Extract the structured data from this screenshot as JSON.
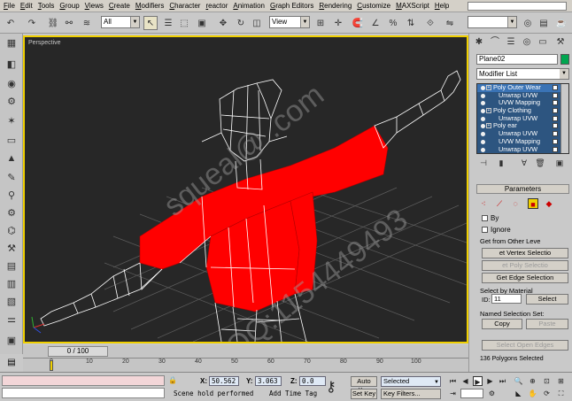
{
  "menubar": {
    "items": [
      "File",
      "Edit",
      "Tools",
      "Group",
      "Views",
      "Create",
      "Modifiers",
      "Character",
      "reactor",
      "Animation",
      "Graph Editors",
      "Rendering",
      "Customize",
      "MAXScript",
      "Help"
    ]
  },
  "toolbar": {
    "selection_filter": "All",
    "ref_coord": "View"
  },
  "viewport": {
    "label": "Perspective",
    "watermark_1": "squeal@ .com",
    "watermark_2": "QQ:1154449493"
  },
  "timeline": {
    "slider_label": "0 / 100",
    "ticks": [
      "0",
      "10",
      "20",
      "30",
      "40",
      "50",
      "60",
      "70",
      "80",
      "90",
      "100"
    ]
  },
  "command_panel": {
    "object_name": "Plane02",
    "modifier_list": "Modifier List",
    "stack": [
      {
        "label": "Poly Outer Wear",
        "selected": true,
        "sub": false
      },
      {
        "label": "Unwrap UVW",
        "selected": false,
        "sub": true
      },
      {
        "label": "UVW Mapping",
        "selected": false,
        "sub": true
      },
      {
        "label": "Poly Clothing",
        "selected": false,
        "sub": false
      },
      {
        "label": "Unwrap UVW",
        "selected": false,
        "sub": true
      },
      {
        "label": "Poly ear",
        "selected": false,
        "sub": false
      },
      {
        "label": "Unwrap UVW",
        "selected": false,
        "sub": true
      },
      {
        "label": "UVW Mapping",
        "selected": false,
        "sub": true
      },
      {
        "label": "Unwrap UVW",
        "selected": false,
        "sub": true
      }
    ],
    "parameters_title": "Parameters",
    "by_label": "By",
    "ignore_label": "Ignore",
    "get_from_other": "Get from Other Leve",
    "get_vertex_btn": "et Vertex Selectio",
    "get_poly_btn": "et Poly Selectio",
    "get_edge_btn": "Get Edge Selection",
    "select_by_material": "Select by Material",
    "id_label": "ID:",
    "id_value": "11",
    "select_btn": "Select",
    "named_sel_sets": "Named Selection Set:",
    "copy_btn": "Copy",
    "paste_btn": "Paste",
    "select_open_edges": "Select Open Edges",
    "polygon_count": "136 Polygons Selected"
  },
  "status": {
    "prompt": "Scene hold performed",
    "x_label": "X:",
    "x_value": "50.562",
    "y_label": "Y:",
    "y_value": "3.063",
    "z_label": "Z:",
    "z_value": "0.0",
    "add_time_tag": "Add Time Tag",
    "auto_key": "Auto Key",
    "set_key": "Set Key",
    "selected_dropdown": "Selected",
    "key_filters": "Key Filters..."
  },
  "colors": {
    "viewport_bg": "#272727",
    "active_border": "#f0d000",
    "wireframe": "#ffffff",
    "selected_faces": "#ff0000",
    "object_color": "#00a650",
    "stack_bg": "#2d5580"
  }
}
